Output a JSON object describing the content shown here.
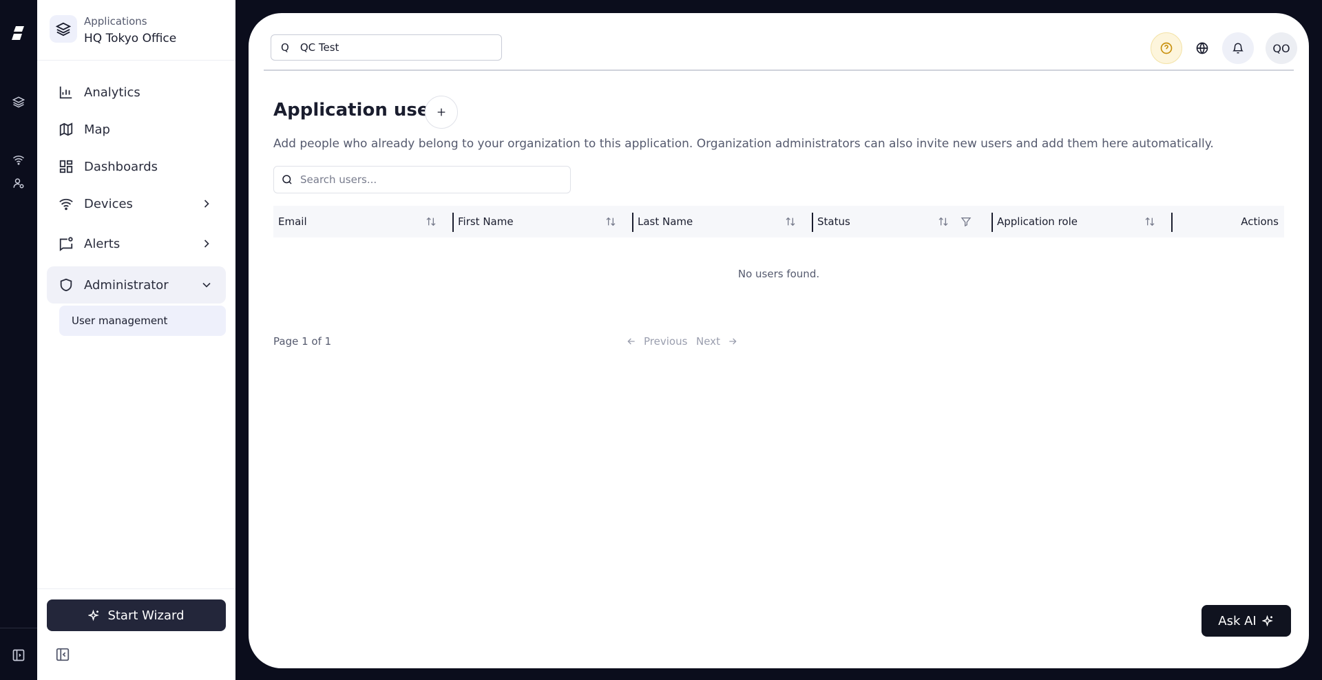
{
  "sidebar": {
    "app_label": "Applications",
    "app_name": "HQ Tokyo Office",
    "nav": [
      {
        "label": "Analytics"
      },
      {
        "label": "Map"
      },
      {
        "label": "Dashboards"
      },
      {
        "label": "Devices"
      },
      {
        "label": "Alerts"
      },
      {
        "label": "Administrator"
      }
    ],
    "sub_item": "User management",
    "wizard_label": "Start Wizard"
  },
  "header": {
    "search_prefix": "Q",
    "search_value": "QC Test",
    "avatar_initials": "QO"
  },
  "page": {
    "title": "Application users",
    "description": "Add people who already belong to your organization to this application. Organization administrators can also invite new users and add them here automatically.",
    "search_placeholder": "Search users...",
    "columns": [
      "Email",
      "First Name",
      "Last Name",
      "Status",
      "Application role",
      "Actions"
    ],
    "empty_text": "No users found.",
    "page_info": "Page 1 of 1",
    "prev_label": "Previous",
    "next_label": "Next",
    "ask_ai_label": "Ask AI"
  },
  "colors": {
    "background": "#0b0d1c",
    "primary_button": "#23263a",
    "help_accent": "#c8900d"
  }
}
